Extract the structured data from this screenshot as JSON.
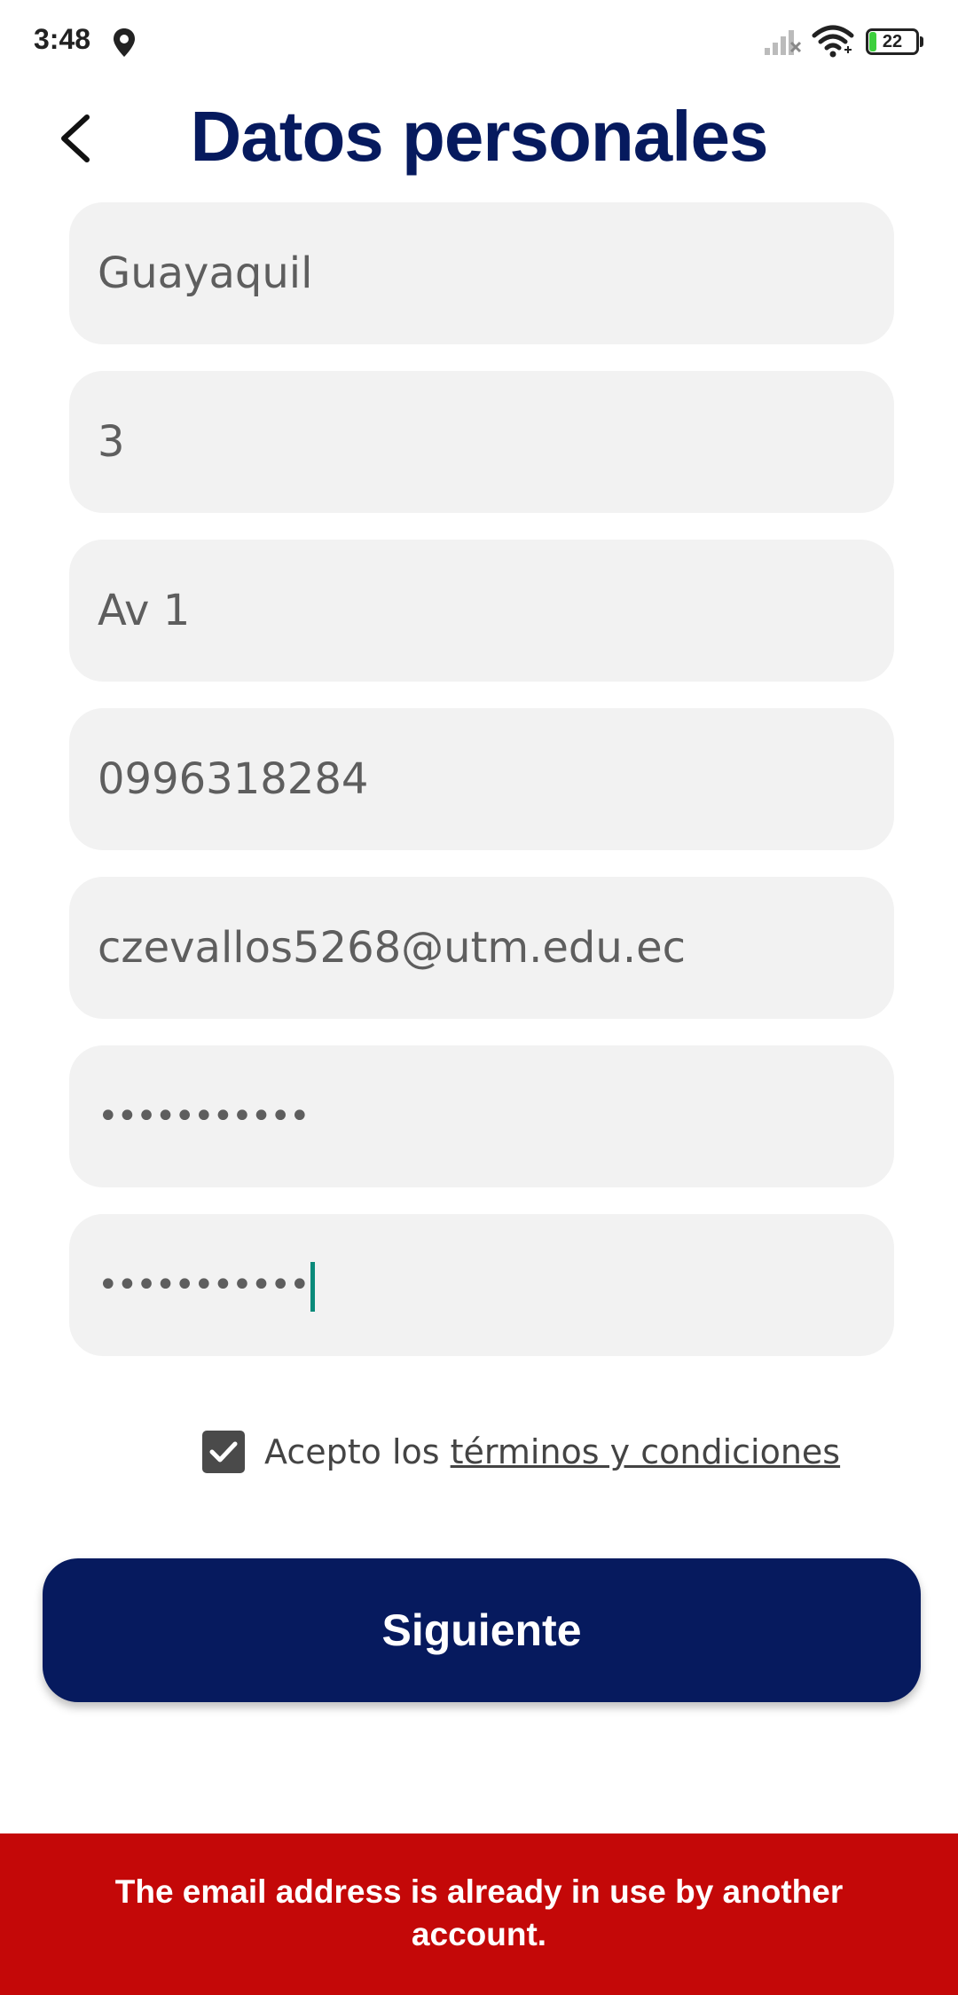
{
  "status_bar": {
    "time": "3:48",
    "battery": "22",
    "icons": [
      "location-icon",
      "signal-icon",
      "wifi-icon",
      "battery-icon"
    ]
  },
  "header": {
    "title": "Datos personales",
    "back_icon": "chevron-left-icon"
  },
  "form": {
    "fields": [
      {
        "value": "Guayaquil"
      },
      {
        "value": "3"
      },
      {
        "value": "Av 1"
      },
      {
        "value": "0996318284"
      },
      {
        "value": "czevallos5268@utm.edu.ec"
      },
      {
        "value": "•••••••••••"
      },
      {
        "value": "•••••••••••"
      }
    ]
  },
  "terms": {
    "checked": true,
    "prefix": "Acepto los ",
    "link": "términos y condiciones"
  },
  "next_button": {
    "label": "Siguiente"
  },
  "error": {
    "message": "The email address is already in use by another account."
  },
  "colors": {
    "primary": "#061a5e",
    "field_bg": "#f2f2f2",
    "error_bg": "#c40808",
    "caret": "#0a8a7a",
    "battery_fill": "#3ccf3c"
  }
}
